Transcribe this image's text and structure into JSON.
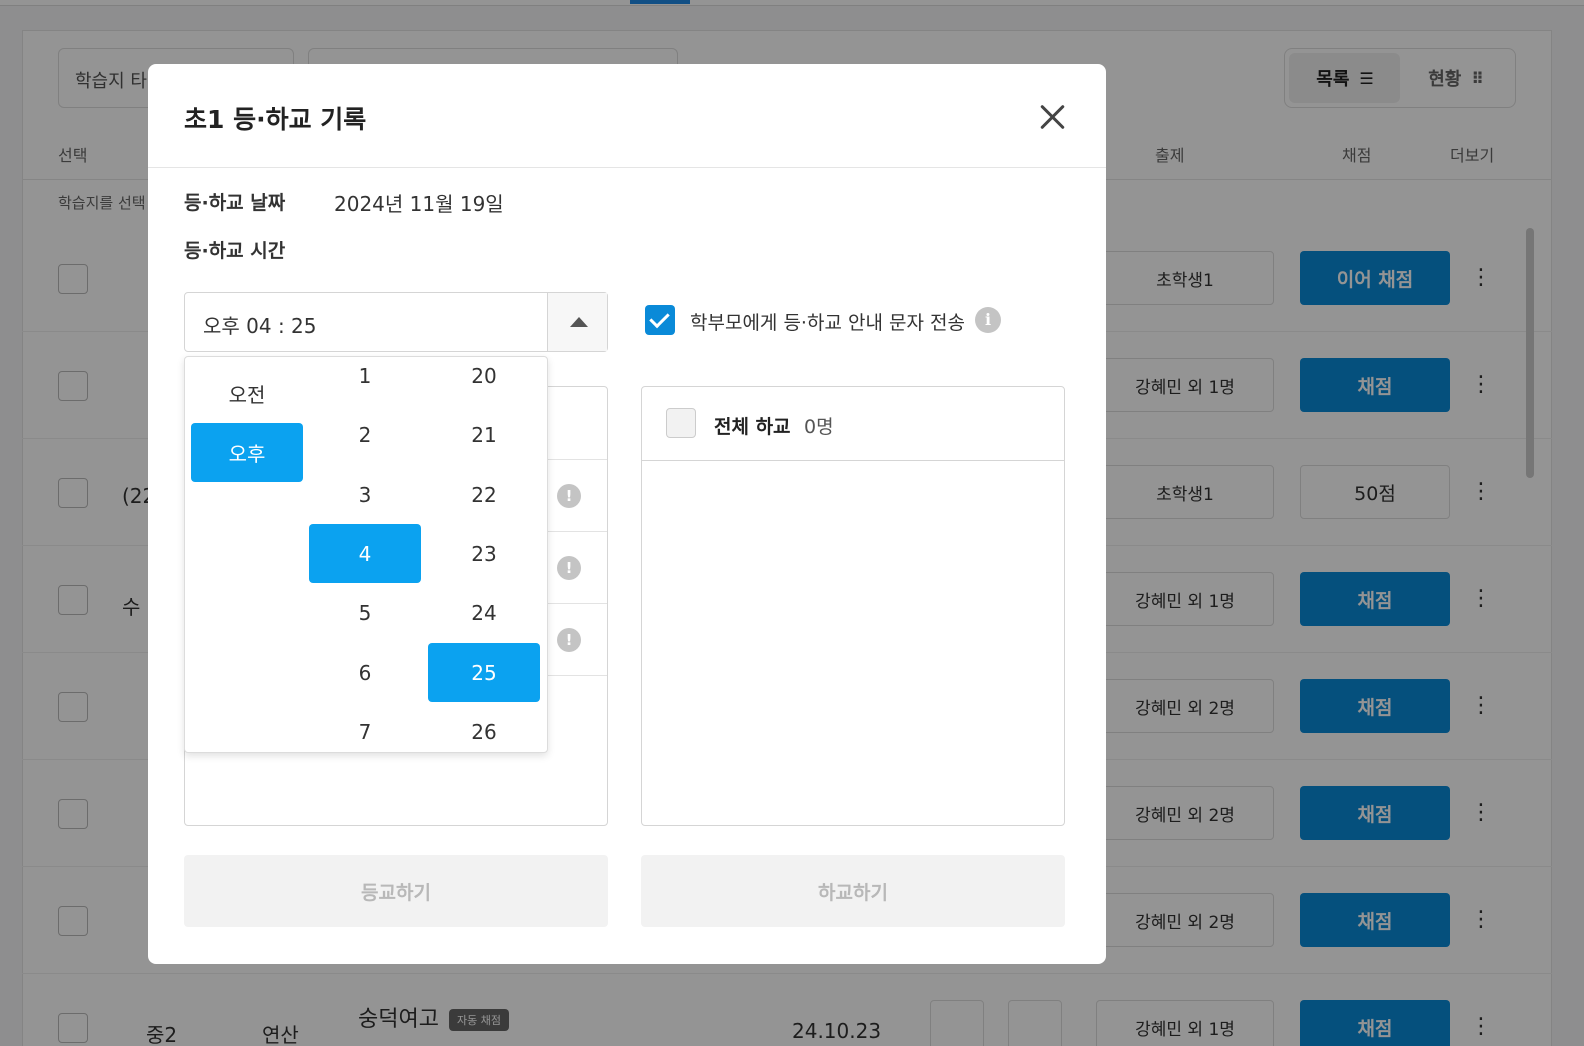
{
  "background": {
    "filter_placeholder": "학습지 타",
    "view_toggle": {
      "list_label": "목록",
      "status_label": "현황"
    },
    "columns": {
      "select": "선택",
      "setter": "출제",
      "grade": "채점",
      "more": "더보기"
    },
    "hint": "학습지를 선택",
    "rows": [
      {
        "setter": "초학생1",
        "action": "이어 채점",
        "action_style": "primary"
      },
      {
        "setter": "강혜민 외 1명",
        "action": "채점",
        "action_style": "primary"
      },
      {
        "setter": "초학생1",
        "action": "50점",
        "action_style": "score",
        "extra": "(22"
      },
      {
        "setter": "강혜민 외 1명",
        "action": "채점",
        "action_style": "primary",
        "extra": "수"
      },
      {
        "setter": "강혜민 외 2명",
        "action": "채점",
        "action_style": "primary"
      },
      {
        "setter": "강혜민 외 2명",
        "action": "채점",
        "action_style": "primary"
      },
      {
        "setter": "강혜민 외 2명",
        "action": "채점",
        "action_style": "primary"
      },
      {
        "setter": "강혜민 외 1명",
        "action": "채점",
        "action_style": "primary",
        "grade_level": "중2",
        "type": "연산",
        "name": "숭덕여고",
        "tag": "자동 채점",
        "date": "24.10.23"
      }
    ],
    "more_icon": "⋮"
  },
  "modal": {
    "title": "초1 등·하교 기록",
    "date_label": "등·하교 날짜",
    "date_value": "2024년 11월 19일",
    "time_label": "등·하교 시간",
    "time_value": "오후 04 : 25",
    "sms_label": "학부모에게 등·하교 안내 문자 전송",
    "sms_checked": true,
    "info_icon_glyph": "i",
    "warn_icon_glyph": "!",
    "right_header_title": "전체 하교",
    "right_header_count": "0명",
    "arrive_button": "등교하기",
    "leave_button": "하교하기"
  },
  "picker": {
    "ampm": [
      "오전",
      "오후"
    ],
    "ampm_selected": "오후",
    "hours": [
      "1",
      "2",
      "3",
      "4",
      "5",
      "6",
      "7"
    ],
    "hour_selected": "4",
    "minutes": [
      "20",
      "21",
      "22",
      "23",
      "24",
      "25",
      "26"
    ],
    "minute_selected": "25"
  },
  "colors": {
    "primary_button": "#0a8ad8",
    "picker_selected": "#0ba2f0",
    "checkbox": "#0a8ad8"
  }
}
